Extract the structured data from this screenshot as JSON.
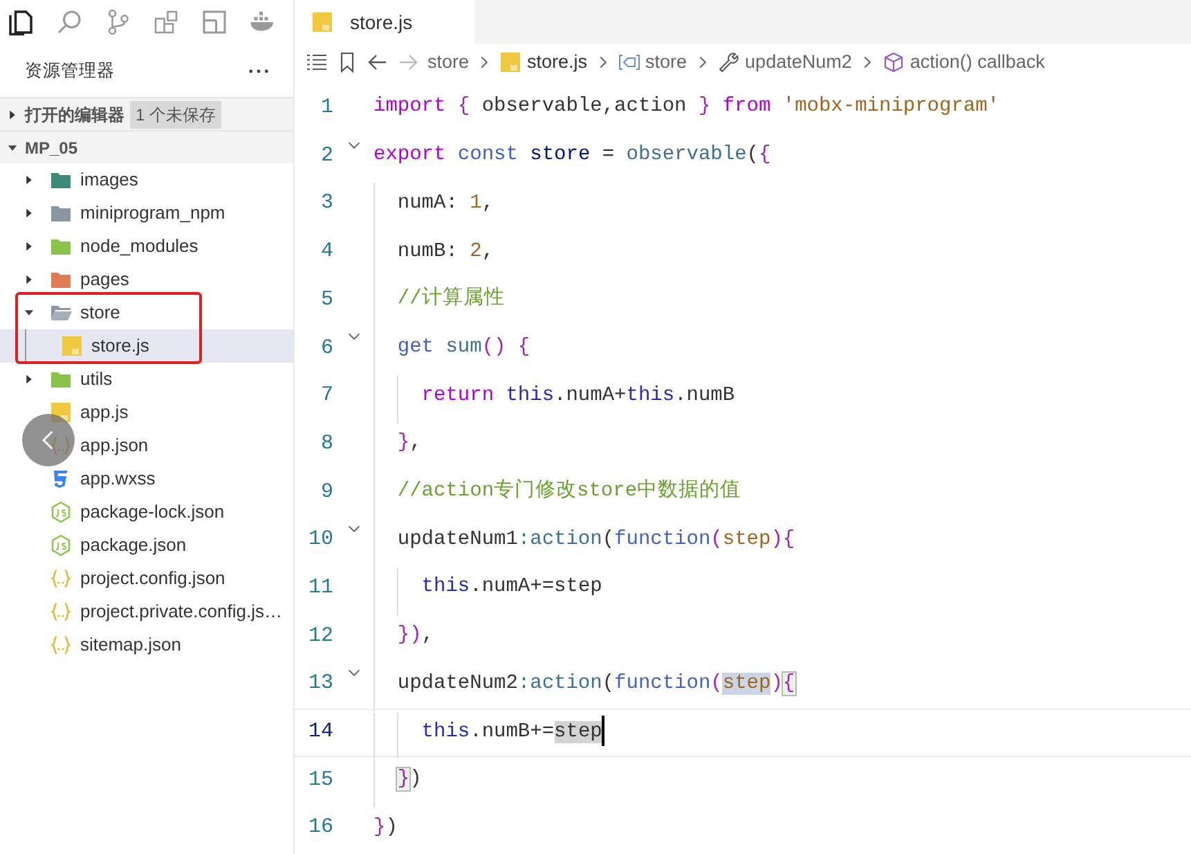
{
  "activity_bar": [
    {
      "kind": "files",
      "selected": true
    },
    {
      "kind": "search",
      "selected": false
    },
    {
      "kind": "source-control",
      "selected": false
    },
    {
      "kind": "extensions",
      "selected": false
    },
    {
      "kind": "layout",
      "selected": false
    },
    {
      "kind": "docker",
      "selected": false
    }
  ],
  "sidebar": {
    "title": "资源管理器",
    "sections": [
      {
        "label": "打开的编辑器",
        "expanded": false,
        "badge": "1 个未保存"
      },
      {
        "label": "MP_05",
        "expanded": true
      }
    ],
    "tree": [
      {
        "label": "images",
        "kind": "folder",
        "color": "#3e8a7a",
        "expanded": false,
        "selected": false
      },
      {
        "label": "miniprogram_npm",
        "kind": "folder",
        "color": "#8a96a3",
        "expanded": false,
        "selected": false
      },
      {
        "label": "node_modules",
        "kind": "folder",
        "color": "#8bc34a",
        "expanded": false,
        "selected": false
      },
      {
        "label": "pages",
        "kind": "folder",
        "color": "#e07b53",
        "expanded": false,
        "selected": false
      },
      {
        "label": "store",
        "kind": "folder",
        "color": "#8a96a3",
        "expanded": true,
        "selected": false,
        "annotated": true,
        "children": [
          {
            "label": "store.js",
            "kind": "js",
            "selected": true
          }
        ]
      },
      {
        "label": "utils",
        "kind": "folder",
        "color": "#8bc34a",
        "expanded": false,
        "selected": false
      },
      {
        "label": "app.js",
        "kind": "js",
        "selected": false
      },
      {
        "label": "app.json",
        "kind": "json",
        "selected": false
      },
      {
        "label": "app.wxss",
        "kind": "css",
        "selected": false
      },
      {
        "label": "package-lock.json",
        "kind": "node",
        "selected": false
      },
      {
        "label": "package.json",
        "kind": "node",
        "selected": false
      },
      {
        "label": "project.config.json",
        "kind": "json",
        "selected": false
      },
      {
        "label": "project.private.config.js…",
        "kind": "json",
        "selected": false
      },
      {
        "label": "sitemap.json",
        "kind": "json",
        "selected": false
      }
    ]
  },
  "tabs": [
    {
      "label": "store.js",
      "kind": "js",
      "dirty": true,
      "selected": true
    }
  ],
  "breadcrumb": [
    {
      "label": "store",
      "kind": "folder"
    },
    {
      "label": "store.js",
      "kind": "js"
    },
    {
      "label": "store",
      "kind": "variable"
    },
    {
      "label": "updateNum2",
      "kind": "property"
    },
    {
      "label": "action() callback",
      "kind": "method"
    }
  ],
  "code": [
    {
      "number": "1",
      "fold": false,
      "current": false,
      "tokens": [
        {
          "t": "import ",
          "kind": "keyword"
        },
        {
          "t": "{",
          "kind": "bracket"
        },
        {
          "t": " observable,action ",
          "kind": "plain"
        },
        {
          "t": "} ",
          "kind": "bracket"
        },
        {
          "t": "from ",
          "kind": "keyword"
        },
        {
          "t": "'mobx-miniprogram'",
          "kind": "string"
        }
      ]
    },
    {
      "number": "2",
      "fold": true,
      "current": false,
      "tokens": [
        {
          "t": "export ",
          "kind": "keyword"
        },
        {
          "t": "const ",
          "kind": "storage"
        },
        {
          "t": "store",
          "kind": "variable"
        },
        {
          "t": " = ",
          "kind": "plain"
        },
        {
          "t": "observable",
          "kind": "function"
        },
        {
          "t": "(",
          "kind": "plain"
        },
        {
          "t": "{",
          "kind": "bracket"
        }
      ]
    },
    {
      "number": "3",
      "fold": false,
      "current": false,
      "tokens": [
        {
          "t": "  numA: ",
          "kind": "plain"
        },
        {
          "t": "1",
          "kind": "number"
        },
        {
          "t": ",",
          "kind": "plain"
        }
      ]
    },
    {
      "number": "4",
      "fold": false,
      "current": false,
      "tokens": [
        {
          "t": "  numB: ",
          "kind": "plain"
        },
        {
          "t": "2",
          "kind": "number"
        },
        {
          "t": ",",
          "kind": "plain"
        }
      ]
    },
    {
      "number": "5",
      "fold": false,
      "current": false,
      "tokens": [
        {
          "t": "  //计算属性",
          "kind": "comment"
        }
      ]
    },
    {
      "number": "6",
      "fold": true,
      "current": false,
      "tokens": [
        {
          "t": "  get ",
          "kind": "storage"
        },
        {
          "t": "sum",
          "kind": "function"
        },
        {
          "t": "() {",
          "kind": "bracket"
        }
      ]
    },
    {
      "number": "7",
      "fold": false,
      "current": false,
      "tokens": [
        {
          "t": "    return ",
          "kind": "keyword"
        },
        {
          "t": "this",
          "kind": "this"
        },
        {
          "t": ".numA+",
          "kind": "plain"
        },
        {
          "t": "this",
          "kind": "this"
        },
        {
          "t": ".numB",
          "kind": "plain"
        }
      ]
    },
    {
      "number": "8",
      "fold": false,
      "current": false,
      "tokens": [
        {
          "t": "  }",
          "kind": "bracket"
        },
        {
          "t": ",",
          "kind": "plain"
        }
      ]
    },
    {
      "number": "9",
      "fold": false,
      "current": false,
      "tokens": [
        {
          "t": "  //action专门修改store中数据的值",
          "kind": "comment"
        }
      ]
    },
    {
      "number": "10",
      "fold": true,
      "current": false,
      "tokens": [
        {
          "t": "  updateNum1",
          "kind": "plain"
        },
        {
          "t": ":",
          "kind": "function"
        },
        {
          "t": "action",
          "kind": "function"
        },
        {
          "t": "(",
          "kind": "plain"
        },
        {
          "t": "function",
          "kind": "storage"
        },
        {
          "t": "(",
          "kind": "bracket"
        },
        {
          "t": "step",
          "kind": "param"
        },
        {
          "t": ")",
          "kind": "bracket"
        },
        {
          "t": "{",
          "kind": "bracket"
        }
      ]
    },
    {
      "number": "11",
      "fold": false,
      "current": false,
      "tokens": [
        {
          "t": "    this",
          "kind": "this"
        },
        {
          "t": ".numA+=step",
          "kind": "plain"
        }
      ]
    },
    {
      "number": "12",
      "fold": false,
      "current": false,
      "tokens": [
        {
          "t": "  })",
          "kind": "bracket"
        },
        {
          "t": ",",
          "kind": "plain"
        }
      ]
    },
    {
      "number": "13",
      "fold": true,
      "current": false,
      "tokens": [
        {
          "t": "  updateNum2",
          "kind": "plain"
        },
        {
          "t": ":",
          "kind": "function"
        },
        {
          "t": "action",
          "kind": "function"
        },
        {
          "t": "(",
          "kind": "plain"
        },
        {
          "t": "function",
          "kind": "storage"
        },
        {
          "t": "(",
          "kind": "bracket"
        },
        {
          "t": "step",
          "kind": "param",
          "highlighted": true
        },
        {
          "t": ")",
          "kind": "bracket"
        },
        {
          "t": "{",
          "kind": "bracket",
          "bracket_match": true
        }
      ]
    },
    {
      "number": "14",
      "fold": false,
      "current": true,
      "tokens": [
        {
          "t": "    this",
          "kind": "this"
        },
        {
          "t": ".numB+=",
          "kind": "plain"
        },
        {
          "t": "step",
          "kind": "plain",
          "in_selection": true
        }
      ]
    },
    {
      "number": "15",
      "fold": false,
      "current": false,
      "tokens": [
        {
          "t": "  }",
          "kind": "bracket",
          "bracket_match": true
        },
        {
          "t": ")",
          "kind": "plain"
        }
      ]
    },
    {
      "number": "16",
      "fold": false,
      "current": false,
      "tokens": [
        {
          "t": "}",
          "kind": "bracket"
        },
        {
          "t": ")",
          "kind": "plain"
        }
      ]
    }
  ]
}
